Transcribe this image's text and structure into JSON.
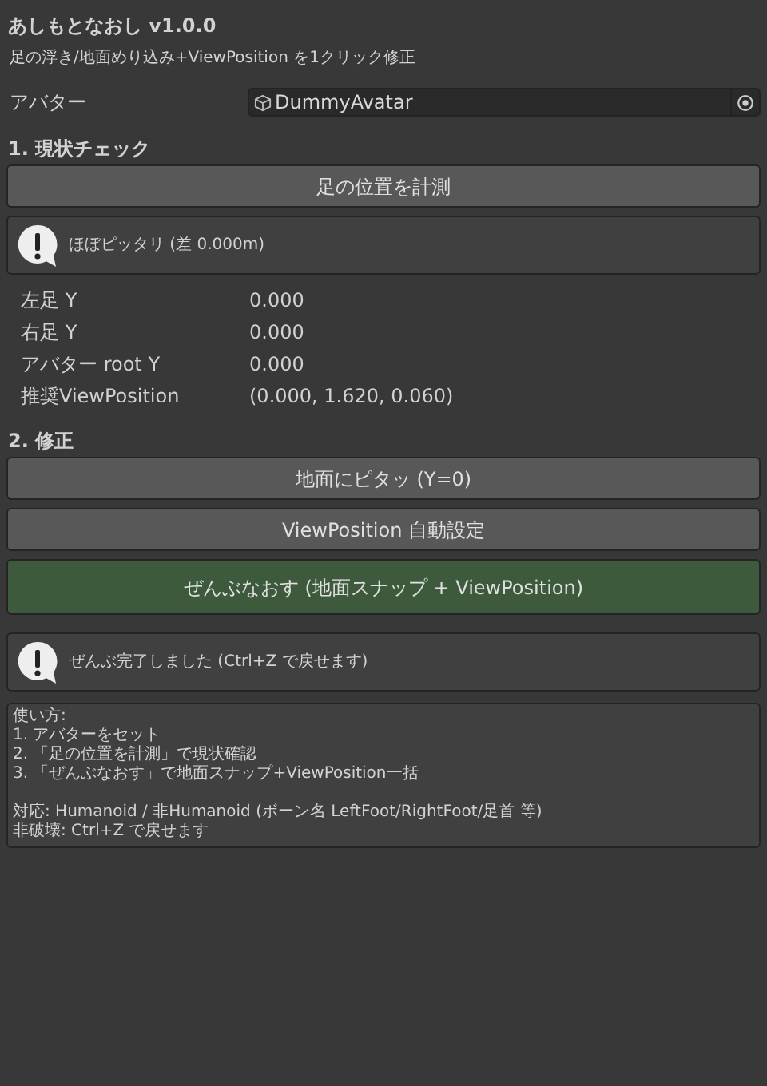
{
  "title": "あしもとなおし v1.0.0",
  "subtitle": "足の浮き/地面めり込み+ViewPosition を1クリック修正",
  "avatar_field": {
    "label": "アバター",
    "value": "DummyAvatar"
  },
  "sections": [
    {
      "heading": "1. 現状チェック",
      "items": [
        {
          "kind": "button",
          "label": "足の位置を計測"
        },
        {
          "kind": "message",
          "text": "ほぼピッタリ (差 0.000m)"
        },
        {
          "kind": "readout",
          "label": "左足 Y",
          "value": "0.000"
        },
        {
          "kind": "readout",
          "label": "右足 Y",
          "value": "0.000"
        },
        {
          "kind": "readout",
          "label": "アバター root Y",
          "value": "0.000"
        },
        {
          "kind": "readout",
          "label": "推奨ViewPosition",
          "value": "(0.000, 1.620, 0.060)"
        }
      ]
    },
    {
      "heading": "2. 修正",
      "items": [
        {
          "kind": "button",
          "label": "地面にピタッ (Y=0)"
        },
        {
          "kind": "button",
          "label": "ViewPosition 自動設定"
        },
        {
          "kind": "primary",
          "label": "ぜんぶなおす (地面スナップ + ViewPosition)"
        },
        {
          "kind": "message",
          "text": "ぜんぶ完了しました (Ctrl+Z で戻せます)"
        }
      ]
    }
  ],
  "usage": [
    [
      "使い方:",
      "1. アバターをセット",
      "2. 「足の位置を計測」で現状確認",
      "3. 「ぜんぶなおす」で地面スナップ+ViewPosition一括"
    ],
    [
      "対応: Humanoid / 非Humanoid (ボーン名 LeftFoot/RightFoot/足首 等)",
      "非破壊: Ctrl+Z で戻せます"
    ]
  ]
}
